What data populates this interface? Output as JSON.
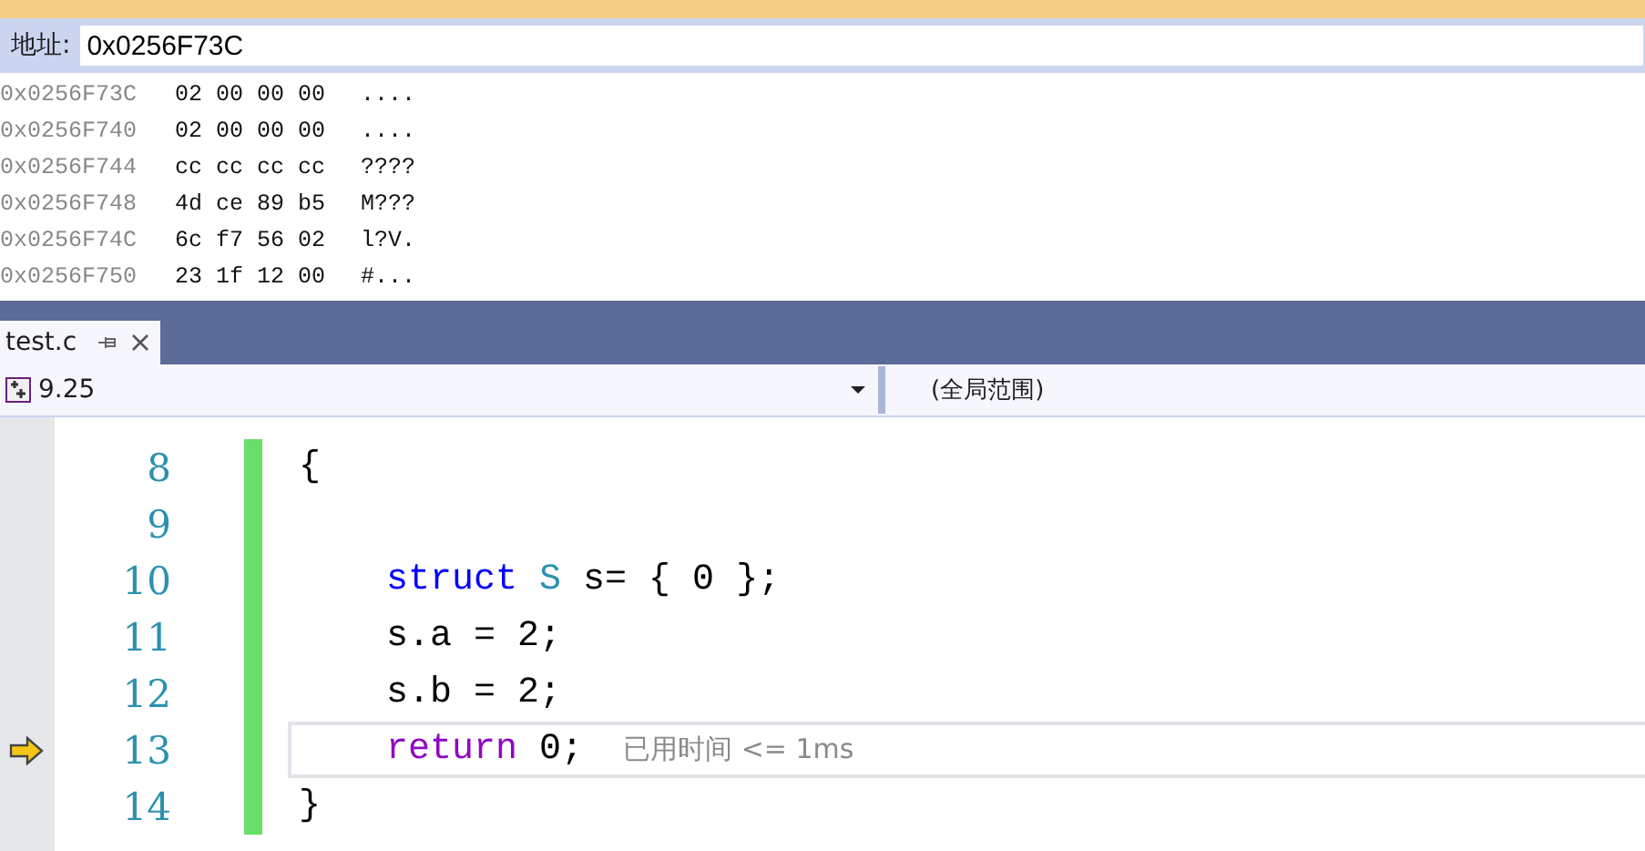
{
  "address_bar": {
    "label": "地址:",
    "value": "0x0256F73C"
  },
  "memory_rows": [
    {
      "address": "0x0256F73C",
      "bytes": "02 00 00 00",
      "ascii": "...."
    },
    {
      "address": "0x0256F740",
      "bytes": "02 00 00 00",
      "ascii": "...."
    },
    {
      "address": "0x0256F744",
      "bytes": "cc cc cc cc",
      "ascii": "????"
    },
    {
      "address": "0x0256F748",
      "bytes": "4d ce 89 b5",
      "ascii": "M???"
    },
    {
      "address": "0x0256F74C",
      "bytes": "6c f7 56 02",
      "ascii": "l?V."
    },
    {
      "address": "0x0256F750",
      "bytes": "23 1f 12 00",
      "ascii": "#..."
    }
  ],
  "tabs": [
    {
      "label": "test.c",
      "selected": true
    }
  ],
  "nav_bar": {
    "project": "9.25",
    "scope": "(全局范围)"
  },
  "code_lines": [
    {
      "number": "8",
      "current": false,
      "tokens": [
        {
          "kind": "plain",
          "text": "{"
        }
      ]
    },
    {
      "number": "9",
      "current": false
    },
    {
      "number": "10",
      "current": false,
      "tokens": [
        {
          "kind": "keyword",
          "text": "    struct"
        },
        {
          "kind": "type",
          "text": " S"
        },
        {
          "kind": "plain",
          "text": " s= { 0 };"
        }
      ]
    },
    {
      "number": "11",
      "current": false,
      "tokens": [
        {
          "kind": "plain",
          "text": "    s.a = 2;"
        }
      ]
    },
    {
      "number": "12",
      "current": false,
      "tokens": [
        {
          "kind": "plain",
          "text": "    s.b = 2;"
        }
      ]
    },
    {
      "number": "13",
      "current": true,
      "tokens": [
        {
          "kind": "control",
          "text": "    return"
        },
        {
          "kind": "plain",
          "text": " 0;"
        }
      ],
      "hint": "已用时间 <= 1ms"
    },
    {
      "number": "14",
      "current": false,
      "tokens": [
        {
          "kind": "plain",
          "text": "}"
        }
      ]
    }
  ]
}
